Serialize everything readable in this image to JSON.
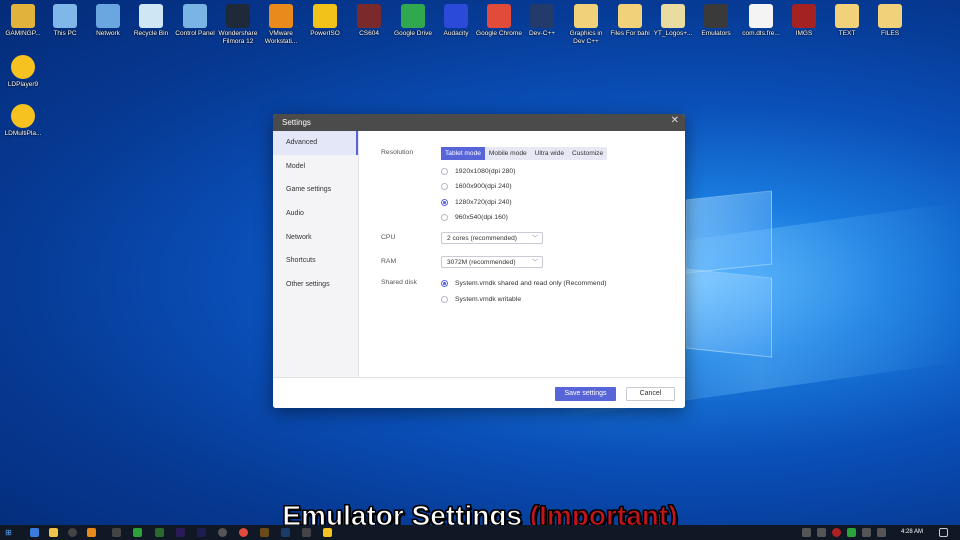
{
  "desktop_icons": [
    {
      "label": "GAMINGP...",
      "icon": "user-folder-icon",
      "color": "#e2b33a"
    },
    {
      "label": "This PC",
      "icon": "computer-icon",
      "color": "#7fb8e8"
    },
    {
      "label": "Network",
      "icon": "network-icon",
      "color": "#6aa6e0"
    },
    {
      "label": "Recycle Bin",
      "icon": "recycle-bin-icon",
      "color": "#cfe6f5"
    },
    {
      "label": "Control Panel",
      "icon": "control-panel-icon",
      "color": "#7ab4e4"
    },
    {
      "label": "Wondershare Filmora 12",
      "icon": "filmora-icon",
      "color": "#1e2a3a"
    },
    {
      "label": "VMware Workstati...",
      "icon": "vmware-icon",
      "color": "#e98a1c"
    },
    {
      "label": "PowerISO",
      "icon": "poweriso-icon",
      "color": "#f2c21b"
    },
    {
      "label": "CS604",
      "icon": "book-icon",
      "color": "#7a2a2a"
    },
    {
      "label": "Google Drive",
      "icon": "google-drive-icon",
      "color": "#2fa84f"
    },
    {
      "label": "Audacity",
      "icon": "audacity-icon",
      "color": "#2c4ad8"
    },
    {
      "label": "Google Chrome",
      "icon": "chrome-icon",
      "color": "#e04b3a"
    },
    {
      "label": "Dev-C++",
      "icon": "devcpp-icon",
      "color": "#223b6a"
    },
    {
      "label": "Graphics in Dev C++",
      "icon": "folder-icon",
      "color": "#f1d27a"
    },
    {
      "label": "Files For bahi",
      "icon": "folder-icon",
      "color": "#f1d27a"
    },
    {
      "label": "YT_Logos+...",
      "icon": "folder-icon",
      "color": "#e9dca0"
    },
    {
      "label": "Emulators",
      "icon": "archive-icon",
      "color": "#3a3a3a"
    },
    {
      "label": "com.dts.fre...",
      "icon": "file-icon",
      "color": "#f4f4f4"
    },
    {
      "label": "IMGS",
      "icon": "archive-icon",
      "color": "#a52222"
    },
    {
      "label": "TEXT",
      "icon": "folder-icon",
      "color": "#f1d27a"
    },
    {
      "label": "FILES",
      "icon": "folder-icon",
      "color": "#f1d27a"
    }
  ],
  "side_icons": [
    {
      "label": "LDPlayer9",
      "icon": "ldplayer-icon",
      "color": "#f6c21f"
    },
    {
      "label": "LDMultiPla...",
      "icon": "ldmultiplayer-icon",
      "color": "#f6c21f"
    }
  ],
  "window": {
    "title": "Settings",
    "close_glyph": "✕"
  },
  "sidebar": {
    "items": [
      {
        "label": "Advanced",
        "active": true
      },
      {
        "label": "Model",
        "active": false
      },
      {
        "label": "Game settings",
        "active": false
      },
      {
        "label": "Audio",
        "active": false
      },
      {
        "label": "Network",
        "active": false
      },
      {
        "label": "Shortcuts",
        "active": false
      },
      {
        "label": "Other settings",
        "active": false
      }
    ]
  },
  "resolution": {
    "label": "Resolution",
    "modes": [
      {
        "label": "Tablet mode",
        "selected": true
      },
      {
        "label": "Mobile mode",
        "selected": false
      },
      {
        "label": "Ultra wide",
        "selected": false
      },
      {
        "label": "Customize",
        "selected": false
      }
    ],
    "options": [
      {
        "label": "1920x1080(dpi 280)",
        "checked": false
      },
      {
        "label": "1600x900(dpi 240)",
        "checked": false
      },
      {
        "label": "1280x720(dpi 240)",
        "checked": true
      },
      {
        "label": "960x540(dpi 160)",
        "checked": false
      }
    ]
  },
  "cpu": {
    "label": "CPU",
    "value": "2 cores (recommended)"
  },
  "ram": {
    "label": "RAM",
    "value": "3072M (recommended)"
  },
  "shared_disk": {
    "label": "Shared disk",
    "options": [
      {
        "label": "System.vmdk shared and read only (Recommend)",
        "checked": true
      },
      {
        "label": "System.vmdk writable",
        "checked": false
      }
    ]
  },
  "footer": {
    "save_label": "Save settings",
    "cancel_label": "Cancel"
  },
  "caption": {
    "main": "Emulator Settings",
    "highlight": "(Important)"
  },
  "taskbar": {
    "time": "4:28 AM"
  },
  "colors": {
    "accent": "#5865d8",
    "caption_highlight": "#c0151b"
  }
}
